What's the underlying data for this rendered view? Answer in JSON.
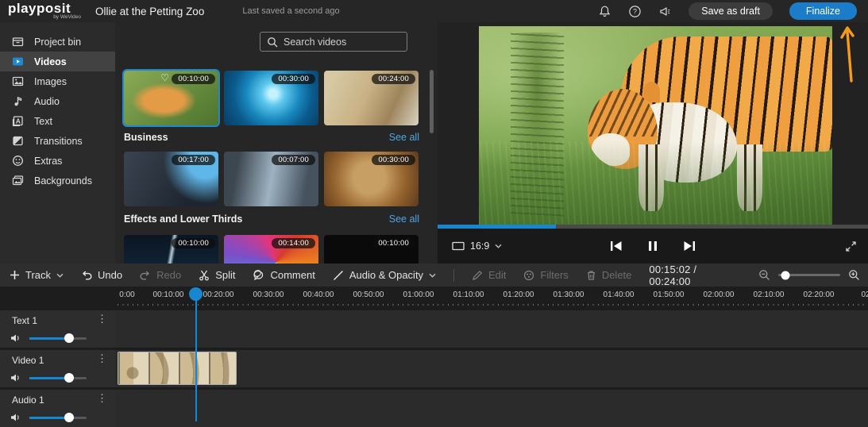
{
  "app": {
    "logo": "playposit",
    "logo_sub": "by WeVideo",
    "title": "Ollie at the Petting Zoo",
    "saved_status": "Last saved a second ago",
    "save_draft_label": "Save as draft",
    "finalize_label": "Finalize"
  },
  "sidebar": {
    "items": [
      {
        "label": "Project bin"
      },
      {
        "label": "Videos",
        "selected": true
      },
      {
        "label": "Images"
      },
      {
        "label": "Audio"
      },
      {
        "label": "Text"
      },
      {
        "label": "Transitions"
      },
      {
        "label": "Extras"
      },
      {
        "label": "Backgrounds"
      }
    ]
  },
  "library": {
    "search_placeholder": "Search videos",
    "row1": [
      {
        "duration": "00:10:00",
        "selected": true,
        "favorited": true
      },
      {
        "duration": "00:30:00"
      },
      {
        "duration": "00:24:00"
      }
    ],
    "cat1": {
      "label": "Business",
      "see_all": "See all"
    },
    "row2": [
      {
        "duration": "00:17:00"
      },
      {
        "duration": "00:07:00"
      },
      {
        "duration": "00:30:00"
      }
    ],
    "cat2": {
      "label": "Effects and Lower Thirds",
      "see_all": "See all"
    },
    "row3": [
      {
        "duration": "00:10:00"
      },
      {
        "duration": "00:14:00"
      },
      {
        "duration": "00:10:00"
      }
    ]
  },
  "preview": {
    "aspect_ratio": "16:9",
    "progress_percent": 28,
    "state": "playing"
  },
  "timeline": {
    "toolbar": {
      "track": "Track",
      "undo": "Undo",
      "redo": "Redo",
      "split": "Split",
      "comment": "Comment",
      "audio_opacity": "Audio & Opacity",
      "edit": "Edit",
      "filters": "Filters",
      "delete": "Delete",
      "timecode": "00:15:02 / 00:24:00"
    },
    "ruler": [
      "0:00",
      "00:10:00",
      "00:20:00",
      "00:30:00",
      "00:40:00",
      "00:50:00",
      "01:00:00",
      "01:10:00",
      "01:20:00",
      "01:30:00",
      "01:40:00",
      "01:50:00",
      "02:00:00",
      "02:10:00",
      "02:20:00",
      "02"
    ],
    "tracks": [
      {
        "name": "Text 1",
        "volume_percent": 70
      },
      {
        "name": "Video 1",
        "volume_percent": 70,
        "has_clip": true
      },
      {
        "name": "Audio 1",
        "volume_percent": 70
      }
    ]
  },
  "annotation": {
    "shape": "arrow",
    "points_to": "finalize-button",
    "color": "#f29b1d"
  },
  "colors": {
    "accent_blue": "#1b7cc9",
    "link_blue": "#51a4e0",
    "playhead_blue": "#1787d2",
    "selected_border": "#1e88d2",
    "arrow_orange": "#f29b1d"
  }
}
